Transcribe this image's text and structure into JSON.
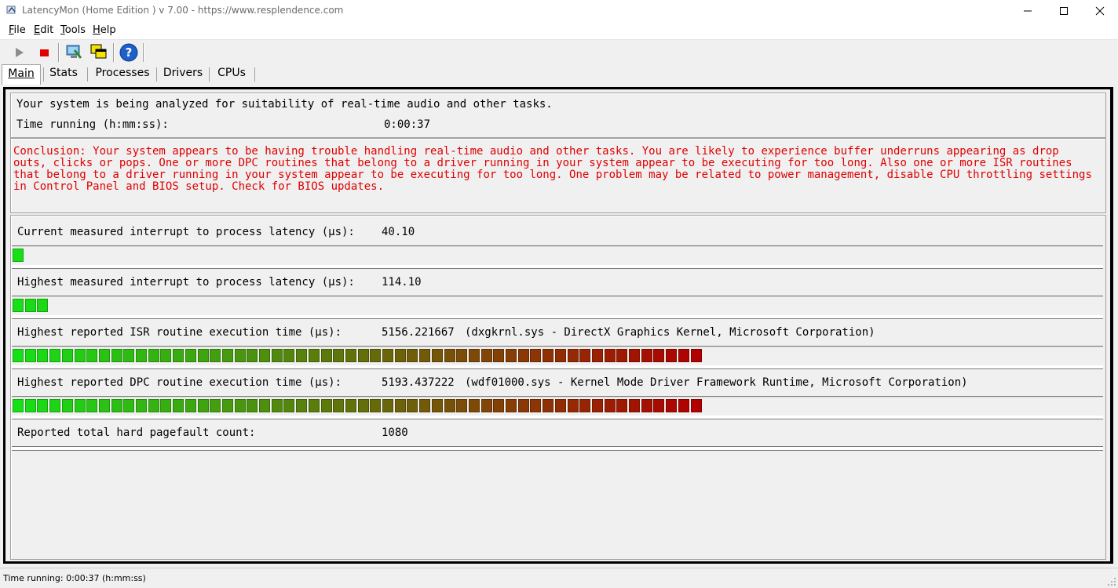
{
  "window": {
    "title": "LatencyMon  (Home Edition )  v 7.00 - https://www.resplendence.com"
  },
  "menu": {
    "items": [
      {
        "label": "File",
        "accel": "F",
        "rest": "ile"
      },
      {
        "label": "Edit",
        "accel": "E",
        "rest": "dit"
      },
      {
        "label": "Tools",
        "accel": "T",
        "rest": "ools"
      },
      {
        "label": "Help",
        "accel": "H",
        "rest": "elp"
      }
    ]
  },
  "toolbar": {
    "icons": [
      "play-icon",
      "stop-icon",
      "computer-icon",
      "windows-icon",
      "help-icon"
    ]
  },
  "tabs": [
    {
      "label": "Main",
      "active": true
    },
    {
      "label": "Stats",
      "active": false
    },
    {
      "label": "Processes",
      "active": false
    },
    {
      "label": "Drivers",
      "active": false
    },
    {
      "label": "CPUs",
      "active": false
    }
  ],
  "summary": {
    "analyzing_text": "Your system is being analyzed for suitability of real-time audio and other tasks.",
    "time_running_label": "Time running (h:mm:ss):",
    "time_running_value": "0:00:37"
  },
  "conclusion": {
    "text": "Conclusion: Your system appears to be having trouble handling real-time audio and other tasks. You are likely to experience buffer underruns appearing as drop outs, clicks or pops. One or more DPC routines that belong to a driver running in your system appear to be executing for too long. Also one or more ISR routines that belong to a driver running in your system appear to be executing for too long. One problem may be related to power management, disable CPU throttling settings in Control Panel and BIOS setup. Check for BIOS updates.",
    "color": "#e00000"
  },
  "metrics": [
    {
      "label": "Current measured interrupt to process latency (µs):",
      "value": "40.10",
      "detail": "",
      "segments": 1
    },
    {
      "label": "Highest measured interrupt to process latency (µs):",
      "value": "114.10",
      "detail": "",
      "segments": 3
    },
    {
      "label": "Highest reported ISR routine execution time (µs):",
      "value": "5156.221667",
      "detail": "(dxgkrnl.sys - DirectX Graphics Kernel, Microsoft Corporation)",
      "segments": 56
    },
    {
      "label": "Highest reported DPC routine execution time (µs):",
      "value": "5193.437222",
      "detail": "(wdf01000.sys - Kernel Mode Driver Framework Runtime, Microsoft Corporation)",
      "segments": 56
    },
    {
      "label": "Reported total hard pagefault count:",
      "value": "1080",
      "detail": "",
      "segments": 0
    }
  ],
  "meter_colors": {
    "start": "#16e016",
    "end": "#b00000"
  },
  "status": {
    "text": "Time running: 0:00:37  (h:mm:ss)"
  }
}
